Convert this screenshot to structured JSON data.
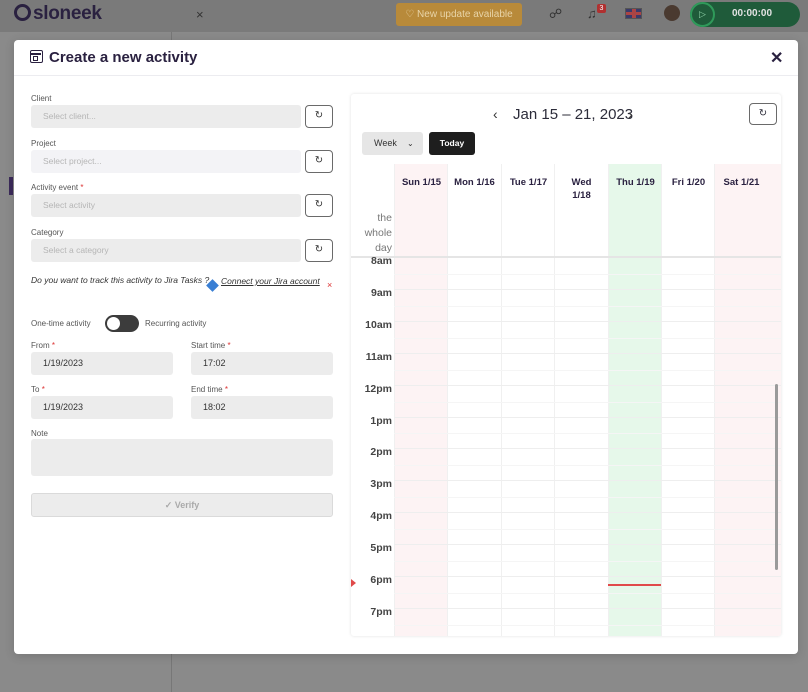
{
  "appbar": {
    "logo": "sloneek",
    "close_tab": "×",
    "update_label": "♡ New update available",
    "chat_icon": "☍",
    "bell_icon": "♫",
    "notifications_badge": "3",
    "timer": "00:00:00",
    "play_icon": "▷"
  },
  "modal": {
    "title": "Create a new activity",
    "close": "✕"
  },
  "form": {
    "client_label": "Client",
    "client_placeholder": "Select client...",
    "project_label": "Project",
    "project_placeholder": "Select project...",
    "activity_label": "Activity event",
    "activity_placeholder": "Select activity",
    "category_label": "Category",
    "category_placeholder": "Select a category",
    "required_mark": "*",
    "refresh_icon": "↻",
    "jira_question": "Do you want to track this activity to Jira Tasks ?",
    "jira_link": "Connect your Jira account",
    "jira_dismiss": "×",
    "one_time": "One-time activity",
    "recurring": "Recurring activity",
    "from_label": "From",
    "from_value": "1/19/2023",
    "start_label": "Start time",
    "start_value": "17:02",
    "to_label": "To",
    "to_value": "1/19/2023",
    "end_label": "End time",
    "end_value": "18:02",
    "note_label": "Note",
    "verify": "✓ Verify"
  },
  "calendar": {
    "title": "Jan 15 – 21, 2023",
    "prev": "‹",
    "next": "›",
    "view": "Week",
    "view_chevron": "⌄",
    "today": "Today",
    "refresh_icon": "↻",
    "allday": "the whole day",
    "days": [
      {
        "label": "Sun 1/15"
      },
      {
        "label": "Mon 1/16"
      },
      {
        "label": "Tue 1/17"
      },
      {
        "label": "Wed 1/18"
      },
      {
        "label": "Thu 1/19"
      },
      {
        "label": "Fri 1/20"
      },
      {
        "label": "Sat 1/21"
      }
    ],
    "hours": [
      "8am",
      "9am",
      "10am",
      "11am",
      "12pm",
      "1pm",
      "2pm",
      "3pm",
      "4pm",
      "5pm",
      "6pm",
      "7pm"
    ],
    "colors": {
      "weekend": "#fdf3f4",
      "today": "#e6f8ea",
      "now_line": "#e04a4a"
    }
  }
}
